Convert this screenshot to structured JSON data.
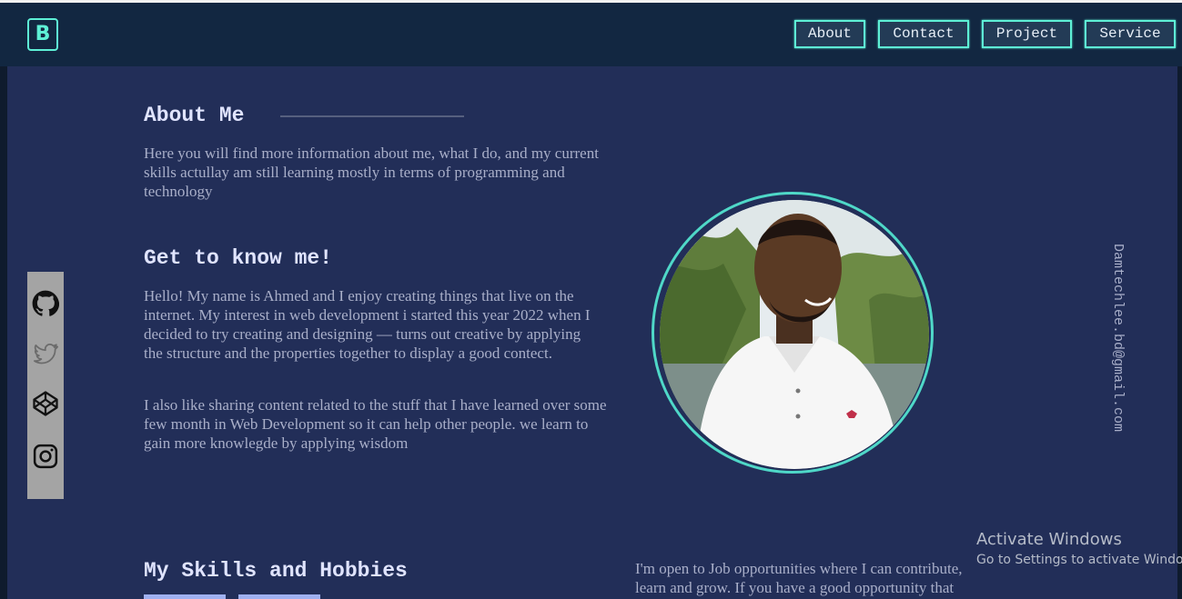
{
  "brand": {
    "logo_letter": "B"
  },
  "nav": {
    "items": [
      {
        "label": "About"
      },
      {
        "label": "Contact"
      },
      {
        "label": "Project"
      },
      {
        "label": "Service"
      }
    ]
  },
  "about": {
    "title": "About Me",
    "text": "Here you will find more information about me, what I do, and my current skills actullay am still learning mostly in terms of programming and technology"
  },
  "know": {
    "title": "Get to know me!",
    "paragraph1": "Hello! My name is Ahmed and I enjoy creating things that live on the internet. My interest in web development i started this year 2022 when I decided to try creating and designing — turns out creative by applying the structure and the properties together to display a good contect.",
    "paragraph2": "I also like sharing content related to the stuff that I have learned over some few month in Web Development so it can help other people. we learn to gain more knowlegde by applying wisdom"
  },
  "social": {
    "icons": [
      "github-icon",
      "twitter-icon",
      "codepen-icon",
      "instagram-icon"
    ]
  },
  "email": "Damtechlee.bd@gmail.com",
  "skills": {
    "title": "My Skills and Hobbies"
  },
  "opportunity": {
    "text": "I'm open to Job opportunities where I can contribute, learn and grow. If you have a good opportunity that"
  },
  "watermark": {
    "title": "Activate Windows",
    "subtitle": "Go to Settings to activate Windows."
  },
  "colors": {
    "accent": "#5ef0d6",
    "background": "#222e58",
    "navbar": "#122741",
    "text": "#a9afc9",
    "heading": "#e0e4ff"
  }
}
